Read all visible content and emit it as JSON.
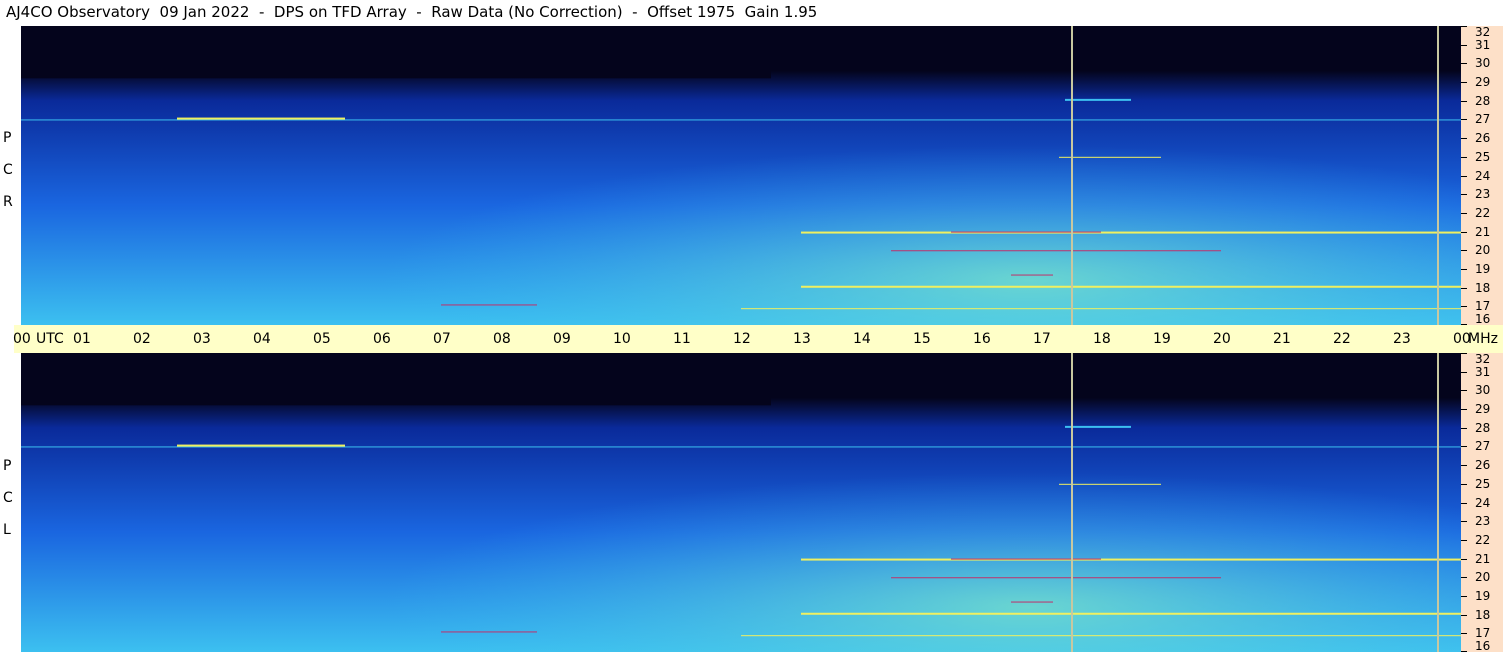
{
  "title": "AJ4CO Observatory  09 Jan 2022  -  DPS on TFD Array  -  Raw Data (No Correction)  -  Offset 1975  Gain 1.95",
  "chart_data": {
    "type": "heatmap",
    "panels": [
      {
        "name": "RCP",
        "label_letters": [
          "P",
          "C",
          "R"
        ]
      },
      {
        "name": "LCP",
        "label_letters": [
          "P",
          "C",
          "L"
        ]
      }
    ],
    "x_axis": {
      "unit": "UTC",
      "ticks": [
        "00",
        "01",
        "02",
        "03",
        "04",
        "05",
        "06",
        "07",
        "08",
        "09",
        "10",
        "11",
        "12",
        "13",
        "14",
        "15",
        "16",
        "17",
        "18",
        "19",
        "20",
        "21",
        "22",
        "23",
        "00"
      ],
      "range_hours": [
        0,
        24
      ]
    },
    "y_axis": {
      "unit": "MHz",
      "ticks": [
        32,
        31,
        30,
        29,
        28,
        27,
        26,
        25,
        24,
        23,
        22,
        21,
        20,
        19,
        18,
        17,
        16
      ],
      "range_mhz": [
        16,
        32
      ]
    },
    "markers_utc_hours": [
      17.5,
      23.6
    ],
    "colors": {
      "background_deep": "#04041c",
      "low": "#0a2a9a",
      "mid": "#1a66e0",
      "high": "#3cc0f0",
      "hot": "#f0f060",
      "marker": "#c8c8a0"
    }
  }
}
